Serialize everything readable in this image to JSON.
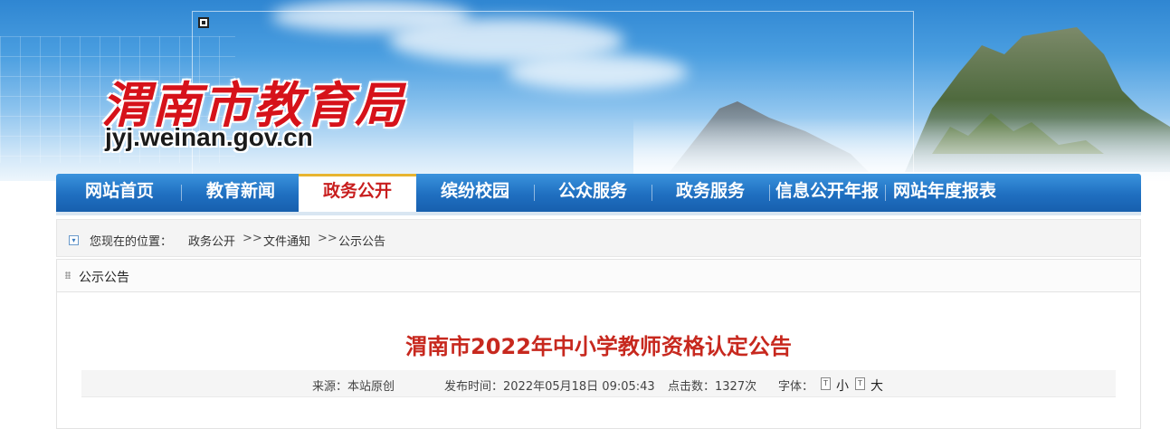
{
  "header": {
    "site_name": "渭南市教育局",
    "site_url": "jyj.weinan.gov.cn"
  },
  "nav": {
    "items": [
      {
        "label": "网站首页",
        "active": false
      },
      {
        "label": "教育新闻",
        "active": false
      },
      {
        "label": "政务公开",
        "active": true
      },
      {
        "label": "缤纷校园",
        "active": false
      },
      {
        "label": "公众服务",
        "active": false
      },
      {
        "label": "政务服务",
        "active": false
      },
      {
        "label": "信息公开年报",
        "active": false
      },
      {
        "label": "网站年度报表",
        "active": false
      }
    ]
  },
  "breadcrumb": {
    "prefix": "您现在的位置：",
    "items": [
      "政务公开",
      "文件通知",
      "公示公告"
    ],
    "separator": ">>"
  },
  "panel": {
    "title": "公示公告"
  },
  "article": {
    "title": "渭南市2022年中小学教师资格认定公告",
    "source": "来源：本站原创",
    "publish_time": "发布时间：2022年05月18日 09:05:43",
    "clicks": "点击数：1327次",
    "font_label": "字体：",
    "font_small": "小",
    "font_large": "大"
  },
  "colors": {
    "nav_blue": "#1f6fc0",
    "active_text": "#c81e1e",
    "title_red": "#c7281e",
    "site_name_red": "#d6121a"
  }
}
